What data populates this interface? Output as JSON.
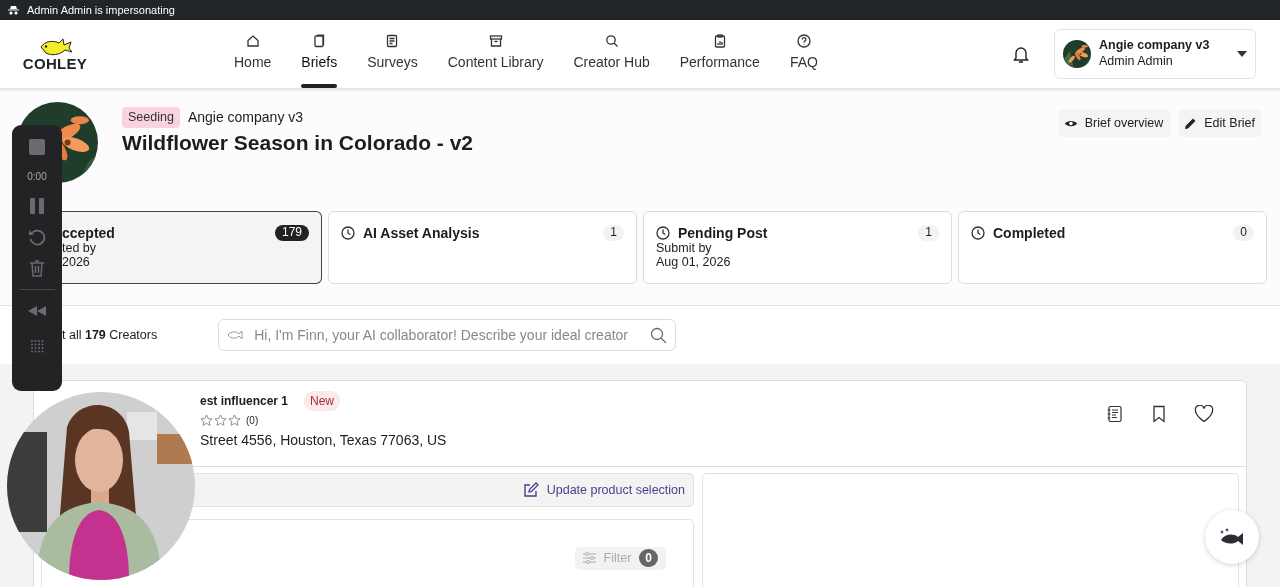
{
  "impersonation_bar": {
    "text": "Admin Admin is impersonating"
  },
  "logo": {
    "text": "COHLEY"
  },
  "nav": [
    {
      "label": "Home",
      "selected": false
    },
    {
      "label": "Briefs",
      "selected": true
    },
    {
      "label": "Surveys",
      "selected": false
    },
    {
      "label": "Content Library",
      "selected": false
    },
    {
      "label": "Creator Hub",
      "selected": false
    },
    {
      "label": "Performance",
      "selected": false
    },
    {
      "label": "FAQ",
      "selected": false
    }
  ],
  "account": {
    "company": "Angie company v3",
    "user": "Admin Admin"
  },
  "brief": {
    "status": "Seeding",
    "company": "Angie company v3",
    "title": "Wildflower Season in Colorado - v2",
    "actions": [
      {
        "label": "Brief overview",
        "kind": "view"
      },
      {
        "label": "Edit Brief",
        "kind": "edit"
      }
    ]
  },
  "stages": [
    {
      "title": "ccepted",
      "lines": [
        "ted by",
        "2026"
      ],
      "count": "179",
      "selected": true,
      "clock": false
    },
    {
      "title": "AI Asset Analysis",
      "count": "1",
      "selected": false,
      "clock": true
    },
    {
      "title": "Pending Post",
      "lines": [
        "Submit by",
        "Aug 01, 2026"
      ],
      "count": "1",
      "selected": false,
      "clock": true
    },
    {
      "title": "Completed",
      "count": "0",
      "selected": false,
      "clock": true
    }
  ],
  "selection": {
    "text": "t all **179** Creators"
  },
  "search": {
    "placeholder": "Hi, I'm Finn, your AI collaborator! Describe your ideal creator"
  },
  "creator": {
    "name": "est influencer 1",
    "tag": "New",
    "stars": 0,
    "rating_count": "(0)",
    "address": "Street 4556, Houston, Texas 77063, US"
  },
  "product_panel": {
    "link": "Update product selection",
    "filter": {
      "label": "Filter",
      "count": "0",
      "disabled": true
    }
  },
  "recorder": {
    "time": "0:00"
  }
}
